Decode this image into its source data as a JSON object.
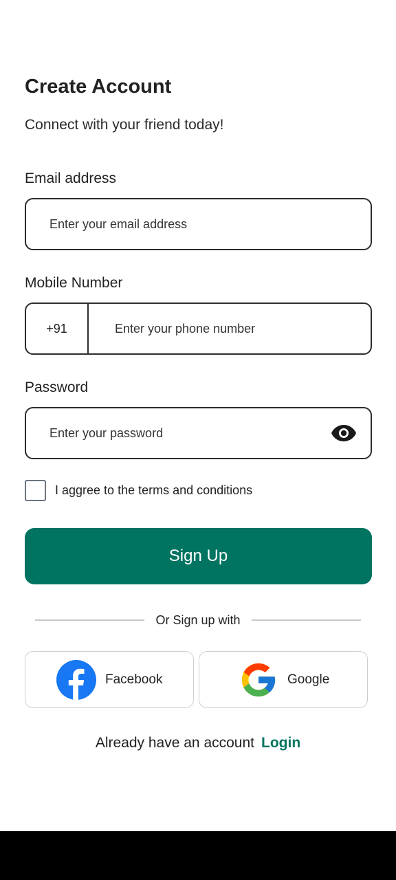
{
  "header": {
    "title": "Create Account",
    "subtitle": "Connect with your friend today!"
  },
  "email": {
    "label": "Email address",
    "placeholder": "Enter your email address"
  },
  "mobile": {
    "label": "Mobile Number",
    "country_code": "+91",
    "placeholder": "Enter your phone number"
  },
  "password": {
    "label": "Password",
    "placeholder": "Enter your password",
    "toggle_icon": "eye-icon"
  },
  "terms": {
    "checked": false,
    "label": "I aggree to the terms and conditions"
  },
  "signup_button": {
    "label": "Sign Up",
    "color": "#007461"
  },
  "divider": {
    "label": "Or Sign up with"
  },
  "social": [
    {
      "label": "Facebook",
      "icon": "facebook-icon",
      "color": "#1877F2"
    },
    {
      "label": "Google",
      "icon": "google-icon"
    }
  ],
  "footer": {
    "prompt": "Already have an account",
    "link": "Login"
  }
}
